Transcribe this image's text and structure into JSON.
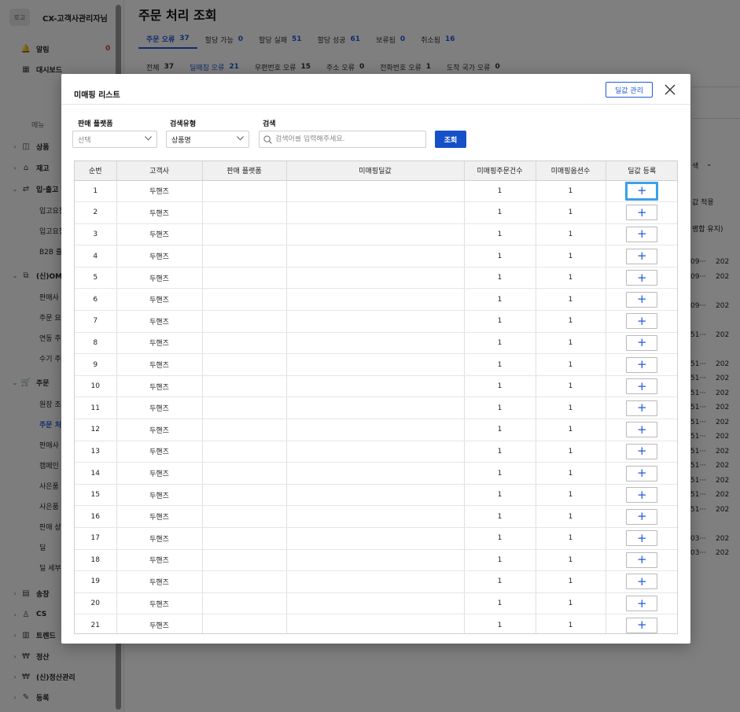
{
  "sidebar": {
    "logo": "로고",
    "account": "CX-고객사관리자님",
    "collapse_icon": "double-chevron-left-icon",
    "alarm": {
      "label": "알림",
      "badge": "0"
    },
    "dashboard": "대시보드",
    "menu_section": "메뉴",
    "groups": [
      "상품",
      "재고",
      "입·출고",
      "(신)OMS",
      "주문",
      "송장",
      "CS",
      "트렌드",
      "정산",
      "(신)정산관리",
      "등록"
    ],
    "inout_items": [
      "입고요청",
      "입고요청",
      "B2B 출고"
    ],
    "oms_items": [
      "판매사",
      "주문 요",
      "연동 주",
      "수기 주"
    ],
    "order_items": [
      "원장 조",
      "주문 처",
      "판매사",
      "캠페인",
      "사은품",
      "사은품",
      "판매 상",
      "딜",
      "딜 세부"
    ]
  },
  "main": {
    "title": "주문 처리 조회",
    "tabs": [
      {
        "label": "주문 오류",
        "count": "37"
      },
      {
        "label": "할당 가능",
        "count": "0"
      },
      {
        "label": "할당 실패",
        "count": "51"
      },
      {
        "label": "할당 성공",
        "count": "61"
      },
      {
        "label": "보류됨",
        "count": "0"
      },
      {
        "label": "취소됨",
        "count": "16"
      }
    ],
    "subtabs": [
      {
        "label": "전체",
        "count": "37"
      },
      {
        "label": "딜매칭 오류",
        "count": "21"
      },
      {
        "label": "우편번호 오류",
        "count": "15"
      },
      {
        "label": "주소 오류",
        "count": "0"
      },
      {
        "label": "전화번호 오류",
        "count": "1"
      },
      {
        "label": "도착 국가 오류",
        "count": "0"
      }
    ],
    "right_fragments": {
      "search_option": "색",
      "apply": "값 적용",
      "keep": "병합 유지)",
      "col_a": [
        "09···",
        "09···",
        "09···",
        "51···",
        "51···",
        "51···",
        "51···",
        "51···",
        "51···",
        "51···",
        "51···",
        "51···",
        "51···",
        "51···",
        "51···",
        "03···",
        "03···"
      ],
      "col_b": "202"
    }
  },
  "modal": {
    "title": "미매핑 리스트",
    "manage_button": "딜값 관리",
    "filters": {
      "platform_label": "판매 플랫폼",
      "platform_value": "선택",
      "search_type_label": "검색유형",
      "search_type_value": "상품명",
      "search_label": "검색",
      "search_placeholder": "검색어를 입력해주세요.",
      "submit": "조회"
    },
    "columns": [
      "순번",
      "고객사",
      "판매 플랫폼",
      "미매핑딜값",
      "미매핑주문건수",
      "미매핑옵션수",
      "딜값 등록"
    ],
    "rows": [
      {
        "no": "1",
        "client": "두핸즈",
        "platform": "",
        "deal": "",
        "orders": "1",
        "options": "1"
      },
      {
        "no": "2",
        "client": "두핸즈",
        "platform": "",
        "deal": "",
        "orders": "1",
        "options": "1"
      },
      {
        "no": "3",
        "client": "두핸즈",
        "platform": "",
        "deal": "",
        "orders": "1",
        "options": "1"
      },
      {
        "no": "4",
        "client": "두핸즈",
        "platform": "",
        "deal": "",
        "orders": "1",
        "options": "1"
      },
      {
        "no": "5",
        "client": "두핸즈",
        "platform": "",
        "deal": "",
        "orders": "1",
        "options": "1"
      },
      {
        "no": "6",
        "client": "두핸즈",
        "platform": "",
        "deal": "",
        "orders": "1",
        "options": "1"
      },
      {
        "no": "7",
        "client": "두핸즈",
        "platform": "",
        "deal": "",
        "orders": "1",
        "options": "1"
      },
      {
        "no": "8",
        "client": "두핸즈",
        "platform": "",
        "deal": "",
        "orders": "1",
        "options": "1"
      },
      {
        "no": "9",
        "client": "두핸즈",
        "platform": "",
        "deal": "",
        "orders": "1",
        "options": "1"
      },
      {
        "no": "10",
        "client": "두핸즈",
        "platform": "",
        "deal": "",
        "orders": "1",
        "options": "1"
      },
      {
        "no": "11",
        "client": "두핸즈",
        "platform": "",
        "deal": "",
        "orders": "1",
        "options": "1"
      },
      {
        "no": "12",
        "client": "두핸즈",
        "platform": "",
        "deal": "",
        "orders": "1",
        "options": "1"
      },
      {
        "no": "13",
        "client": "두핸즈",
        "platform": "",
        "deal": "",
        "orders": "1",
        "options": "1"
      },
      {
        "no": "14",
        "client": "두핸즈",
        "platform": "",
        "deal": "",
        "orders": "1",
        "options": "1"
      },
      {
        "no": "15",
        "client": "두핸즈",
        "platform": "",
        "deal": "",
        "orders": "1",
        "options": "1"
      },
      {
        "no": "16",
        "client": "두핸즈",
        "platform": "",
        "deal": "",
        "orders": "1",
        "options": "1"
      },
      {
        "no": "17",
        "client": "두핸즈",
        "platform": "",
        "deal": "",
        "orders": "1",
        "options": "1"
      },
      {
        "no": "18",
        "client": "두핸즈",
        "platform": "",
        "deal": "",
        "orders": "1",
        "options": "1"
      },
      {
        "no": "19",
        "client": "두핸즈",
        "platform": "",
        "deal": "",
        "orders": "1",
        "options": "1"
      },
      {
        "no": "20",
        "client": "두핸즈",
        "platform": "",
        "deal": "",
        "orders": "1",
        "options": "1"
      },
      {
        "no": "21",
        "client": "두핸즈",
        "platform": "",
        "deal": "",
        "orders": "1",
        "options": "1"
      }
    ],
    "add_symbol": "+",
    "focused_row": "1"
  },
  "colors": {
    "accent": "#1f5bd6",
    "button": "#1550c8",
    "focus_ring": "#3aa0e8",
    "badge": "#e03030"
  }
}
